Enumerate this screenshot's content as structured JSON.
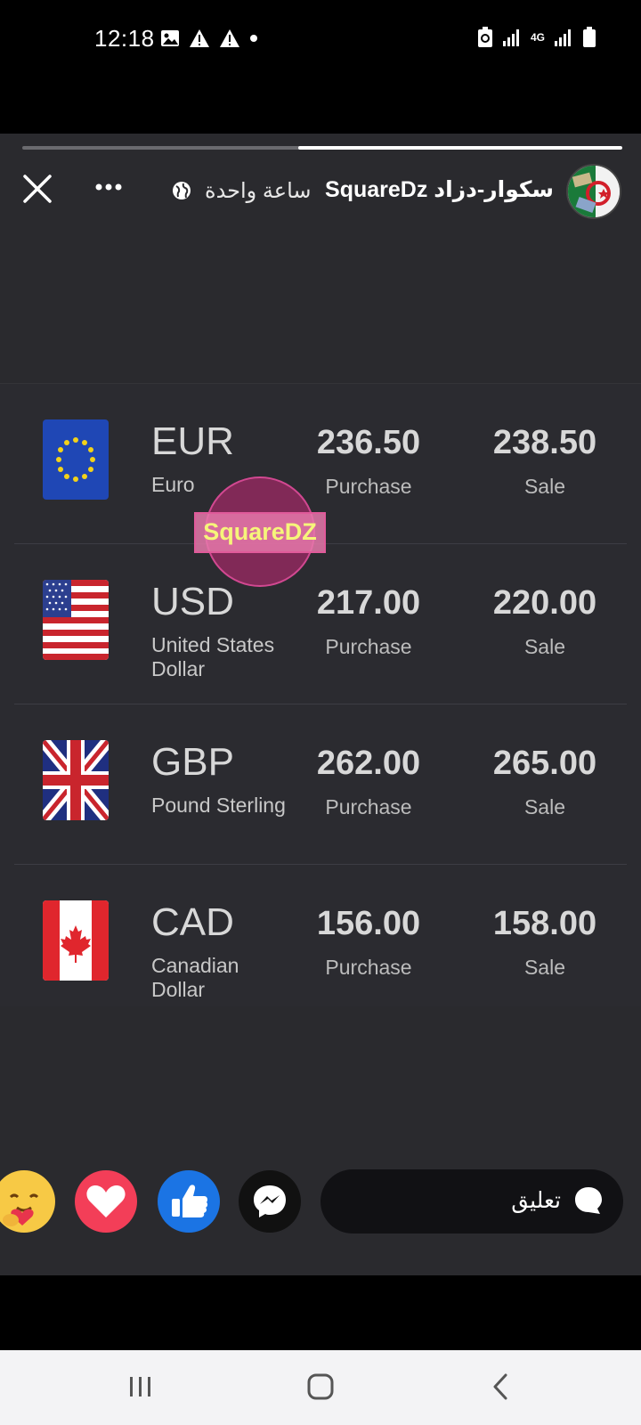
{
  "status_bar": {
    "time": "12:18",
    "icons_left": [
      "gallery-icon",
      "warning-icon",
      "warning-icon",
      "dot-icon"
    ],
    "icons_right": [
      "data-saver-icon",
      "signal-icon",
      "4g-icon",
      "signal-icon",
      "battery-icon"
    ],
    "network_label": "4G"
  },
  "story": {
    "author": "سكوار-دزاد SquareDz",
    "time_ago": "ساعة واحدة",
    "progress_fraction": 0.54
  },
  "rates": [
    {
      "code": "EUR",
      "name": "Euro",
      "purchase": "236.50",
      "purchase_label": "Purchase",
      "sale": "238.50",
      "sale_label": "Sale",
      "flag": "eu-flag"
    },
    {
      "code": "USD",
      "name": "United States Dollar",
      "purchase": "217.00",
      "purchase_label": "Purchase",
      "sale": "220.00",
      "sale_label": "Sale",
      "flag": "us-flag"
    },
    {
      "code": "GBP",
      "name": "Pound Sterling",
      "purchase": "262.00",
      "purchase_label": "Purchase",
      "sale": "265.00",
      "sale_label": "Sale",
      "flag": "uk-flag"
    },
    {
      "code": "CAD",
      "name": "Canadian Dollar",
      "purchase": "156.00",
      "purchase_label": "Purchase",
      "sale": "158.00",
      "sale_label": "Sale",
      "flag": "ca-flag"
    }
  ],
  "watermark": {
    "text": "SquareDZ"
  },
  "reply": {
    "comment_placeholder": "تعليق"
  },
  "colors": {
    "background": "#2a2a2e",
    "like": "#1b74e4",
    "love": "#f33e58",
    "care": "#f7c945"
  }
}
